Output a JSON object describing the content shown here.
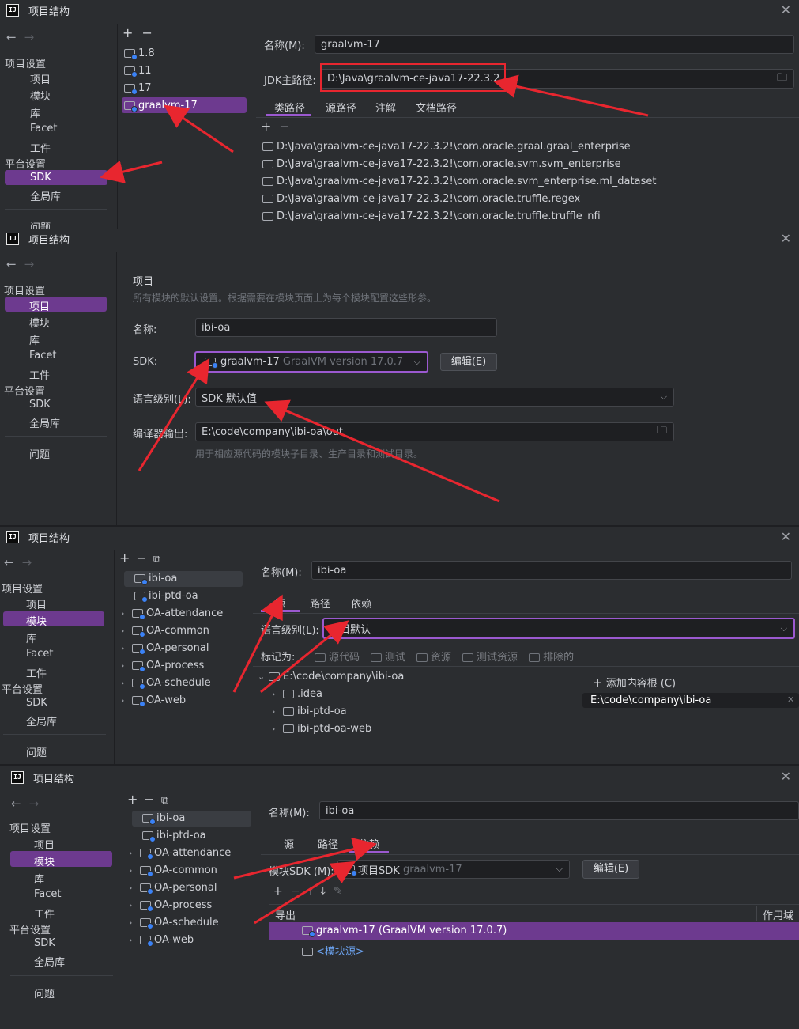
{
  "window_title": "项目结构",
  "nav": {
    "back": "←",
    "forward": "→",
    "project_settings": "项目设置",
    "project": "项目",
    "modules": "模块",
    "libraries": "库",
    "facet": "Facet",
    "artifacts": "工件",
    "platform_settings": "平台设置",
    "sdk": "SDK",
    "global_libraries": "全局库",
    "problems": "问题"
  },
  "toolbar": {
    "add": "+",
    "remove": "−",
    "copy": "⧉"
  },
  "panel1": {
    "sdk_list": [
      "1.8",
      "11",
      "17",
      "graalvm-17"
    ],
    "name_label": "名称(M):",
    "name_value": "graalvm-17",
    "jdk_home_label": "JDK主路径:",
    "jdk_home_value": "D:\\Java\\graalvm-ce-java17-22.3.2",
    "tabs": [
      "类路径",
      "源路径",
      "注解",
      "文档路径"
    ],
    "classpath": [
      "D:\\Java\\graalvm-ce-java17-22.3.2!\\com.oracle.graal.graal_enterprise",
      "D:\\Java\\graalvm-ce-java17-22.3.2!\\com.oracle.svm.svm_enterprise",
      "D:\\Java\\graalvm-ce-java17-22.3.2!\\com.oracle.svm_enterprise.ml_dataset",
      "D:\\Java\\graalvm-ce-java17-22.3.2!\\com.oracle.truffle.regex",
      "D:\\Java\\graalvm-ce-java17-22.3.2!\\com.oracle.truffle.truffle_nfi"
    ]
  },
  "panel2": {
    "heading": "项目",
    "desc": "所有模块的默认设置。根据需要在模块页面上为每个模块配置这些形参。",
    "name_label": "名称:",
    "name_value": "ibi-oa",
    "sdk_label": "SDK:",
    "sdk_value": "graalvm-17",
    "sdk_version": "GraalVM version 17.0.7",
    "edit_button": "编辑(E)",
    "lang_label": "语言级别(L):",
    "lang_value": "SDK 默认值",
    "compiler_label": "编译器输出:",
    "compiler_value": "E:\\code\\company\\ibi-oa\\out",
    "compiler_hint": "用于相应源代码的模块子目录、生产目录和测试目录。"
  },
  "modules_list": [
    "ibi-oa",
    "ibi-ptd-oa",
    "OA-attendance",
    "OA-common",
    "OA-personal",
    "OA-process",
    "OA-schedule",
    "OA-web"
  ],
  "panel3": {
    "name_label": "名称(M):",
    "name_value": "ibi-oa",
    "tabs": [
      "源",
      "路径",
      "依赖"
    ],
    "lang_label": "语言级别(L):",
    "lang_value": "项目默认",
    "mark_as": "标记为:",
    "marks": [
      "源代码",
      "测试",
      "资源",
      "测试资源",
      "排除的"
    ],
    "tree_root": "E:\\code\\company\\ibi-oa",
    "tree_children": [
      ".idea",
      "ibi-ptd-oa",
      "ibi-ptd-oa-web"
    ],
    "add_content_root": "添加内容根 (C)",
    "content_root": "E:\\code\\company\\ibi-oa"
  },
  "panel4": {
    "name_label": "名称(M):",
    "name_value": "ibi-oa",
    "tabs": [
      "源",
      "路径",
      "依赖"
    ],
    "module_sdk_label": "模块SDK (M):",
    "module_sdk_value": "项目SDK",
    "module_sdk_hint": "graalvm-17",
    "edit_button": "编辑(E)",
    "col_export": "导出",
    "col_scope": "作用域",
    "dep1": "graalvm-17 (GraalVM version 17.0.7)",
    "dep2": "<模块源>"
  },
  "colors": {
    "accent": "#6d3a8f",
    "arrow": "#e8262f"
  }
}
